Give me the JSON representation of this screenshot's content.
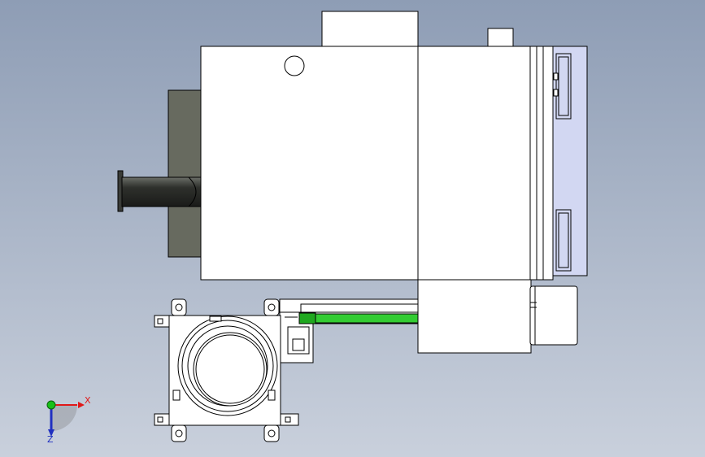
{
  "viewport": {
    "background_top": "#8e9db5",
    "background_bottom": "#c9d0dc"
  },
  "model": {
    "body_fill": "#ffffff",
    "edge_color": "#000000",
    "flange_fill": "#676a5f",
    "shaft_fill": "#2e302c",
    "cover_fill": "#d2d7f2",
    "rail_fill": "#33cc33"
  },
  "triad": {
    "x_label": "X",
    "z_label": "Z",
    "x_color": "#e01818",
    "y_color": "#18c018",
    "z_color": "#2030c0"
  }
}
